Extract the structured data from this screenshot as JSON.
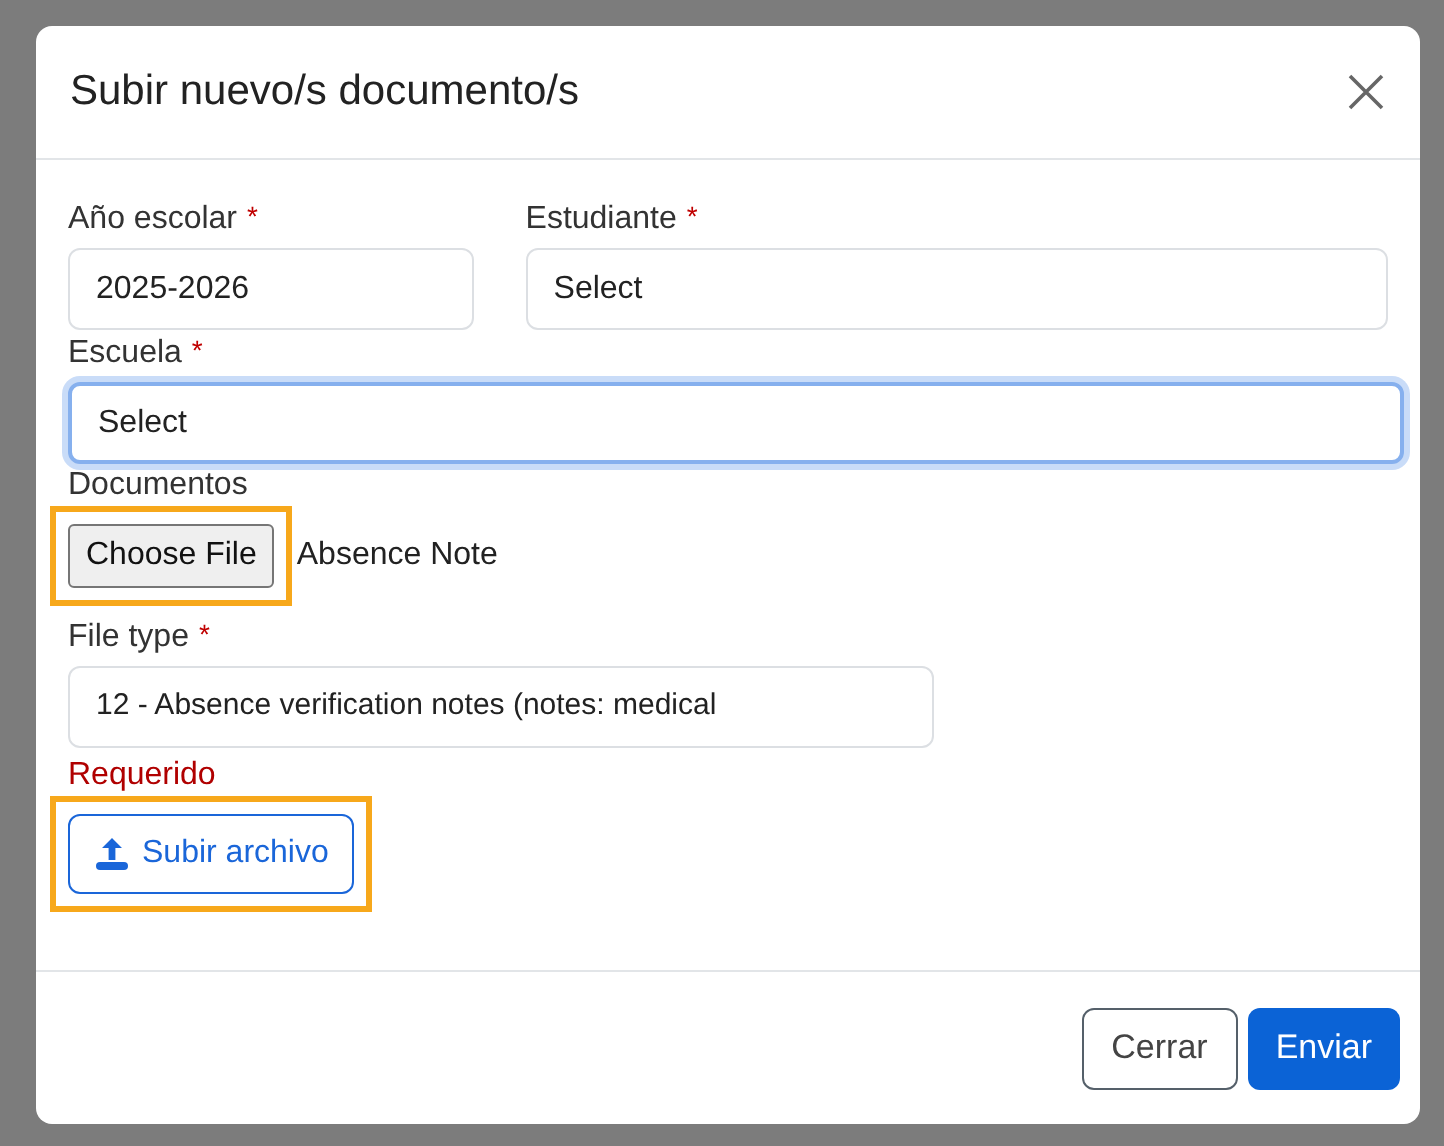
{
  "dialog": {
    "title": "Subir nuevo/s documento/s",
    "fields": [
      {
        "label": "Año escolar",
        "required_mark": "*",
        "value": "2025-2026",
        "focused": false
      },
      {
        "label": "Estudiante",
        "required_mark": "*",
        "value": "Select",
        "focused": false
      },
      {
        "label": "Escuela",
        "required_mark": "*",
        "value": "Select",
        "focused": true
      }
    ],
    "documents": {
      "label": "Documentos",
      "button": "Choose File",
      "file_name": "Absence Note",
      "highlighted": true
    },
    "file_type": {
      "label": "File type",
      "required_mark": "*",
      "value": "12 - Absence verification notes (notes: medical",
      "error": "Requerido"
    },
    "upload_button": {
      "label": "Subir archivo",
      "highlighted": true
    },
    "buttons": [
      {
        "label": "Cerrar",
        "kind": "secondary"
      },
      {
        "label": "Enviar",
        "kind": "primary"
      }
    ]
  }
}
